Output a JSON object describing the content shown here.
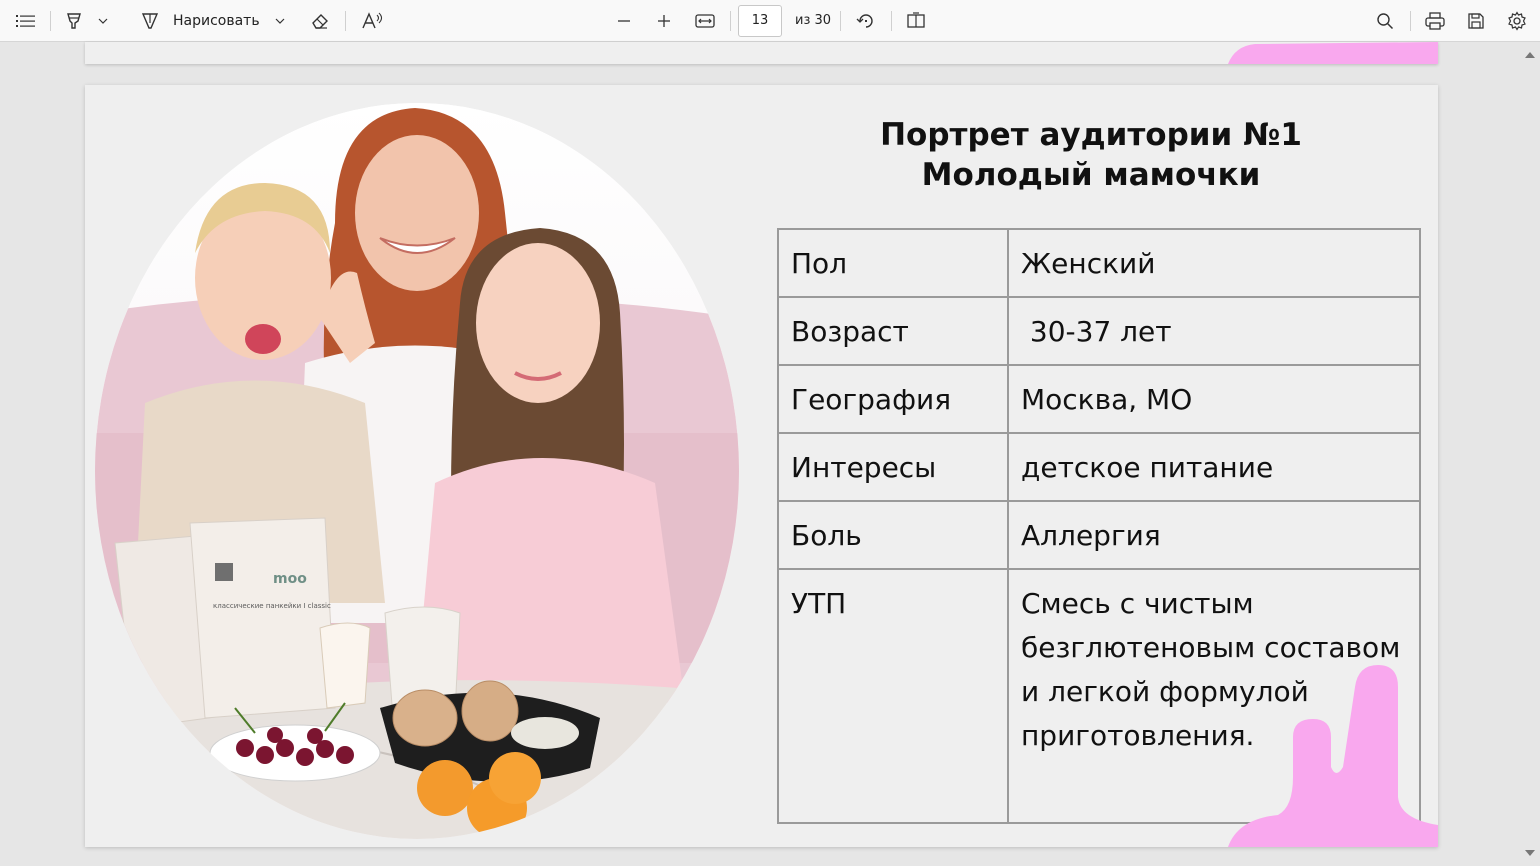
{
  "toolbar": {
    "draw_label": "Нарисовать",
    "page_current": "13",
    "page_total": "из 30"
  },
  "slide": {
    "title_line1": "Портрет аудитории №1",
    "title_line2": "Молодый мамочки",
    "rows": [
      {
        "key": "Пол",
        "value": "Женский"
      },
      {
        "key": "Возраст",
        "value": " 30-37 лет"
      },
      {
        "key": "География",
        "value": "Москва, МО"
      },
      {
        "key": "Интересы",
        "value": "детское питание"
      },
      {
        "key": "Боль",
        "value": "Аллергия"
      },
      {
        "key": "УТП",
        "value": "Смесь с чистым безглютеновым составом и легкой формулой приготовления."
      }
    ],
    "product_pack_text": "классические панкейки I classic",
    "product_brand": "moo"
  },
  "colors": {
    "accent_pink": "#f9a8ee",
    "slide_bg": "#efefef",
    "toolbar_bg": "#f9f9f9"
  },
  "icons": [
    "list-icon",
    "highlighter-icon",
    "chevron-down-icon",
    "draw-icon",
    "eraser-icon",
    "read-aloud-icon",
    "zoom-out-icon",
    "zoom-in-icon",
    "fit-width-icon",
    "rotate-icon",
    "page-view-icon",
    "search-icon",
    "print-icon",
    "save-icon",
    "settings-icon"
  ]
}
